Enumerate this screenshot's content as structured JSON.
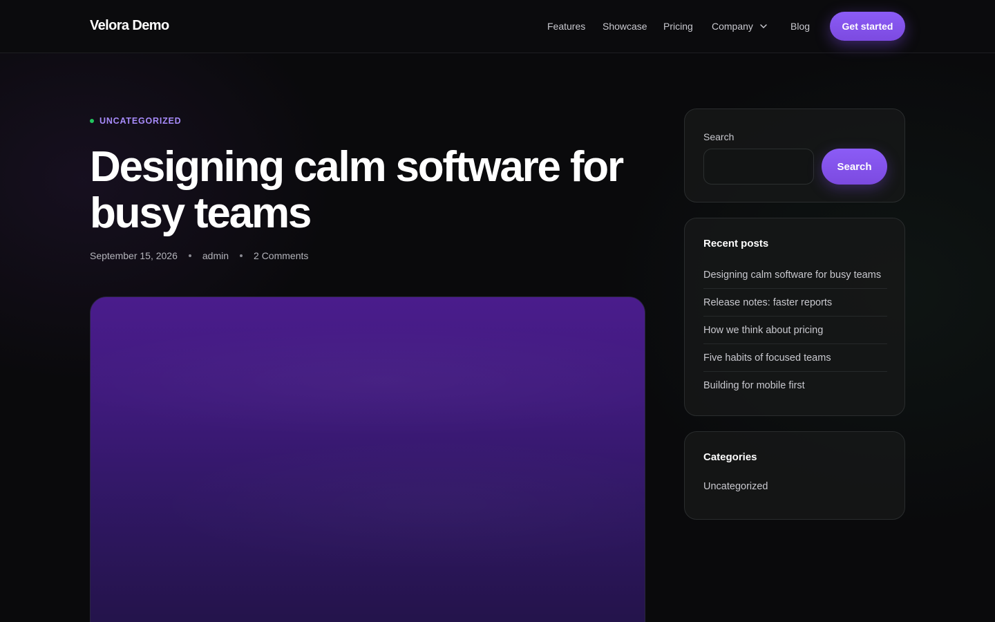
{
  "header": {
    "logo": "Velora Demo",
    "nav": [
      {
        "label": "Features"
      },
      {
        "label": "Showcase"
      },
      {
        "label": "Pricing"
      },
      {
        "label": "Company",
        "icon": "chevron-down-icon"
      },
      {
        "label": "Blog"
      }
    ],
    "cta_label": "Get started"
  },
  "article": {
    "category": "UNCATEGORIZED",
    "title": "Designing calm software for busy teams",
    "date": "September 15, 2026",
    "author": "admin",
    "comments": "2 Comments"
  },
  "sidebar": {
    "search": {
      "label": "Search",
      "placeholder": "",
      "button_label": "Search"
    },
    "recent_posts": {
      "title": "Recent posts",
      "items": [
        "Designing calm software for busy teams",
        "Release notes: faster reports",
        "How we think about pricing",
        "Five habits of focused teams",
        "Building for mobile first"
      ]
    },
    "categories": {
      "title": "Categories",
      "items": [
        "Uncategorized"
      ]
    }
  },
  "colors": {
    "accent": "#8b5cf6",
    "category_label": "#a78bfa",
    "category_dot": "#22c55e",
    "background": "#0a0a0c"
  }
}
